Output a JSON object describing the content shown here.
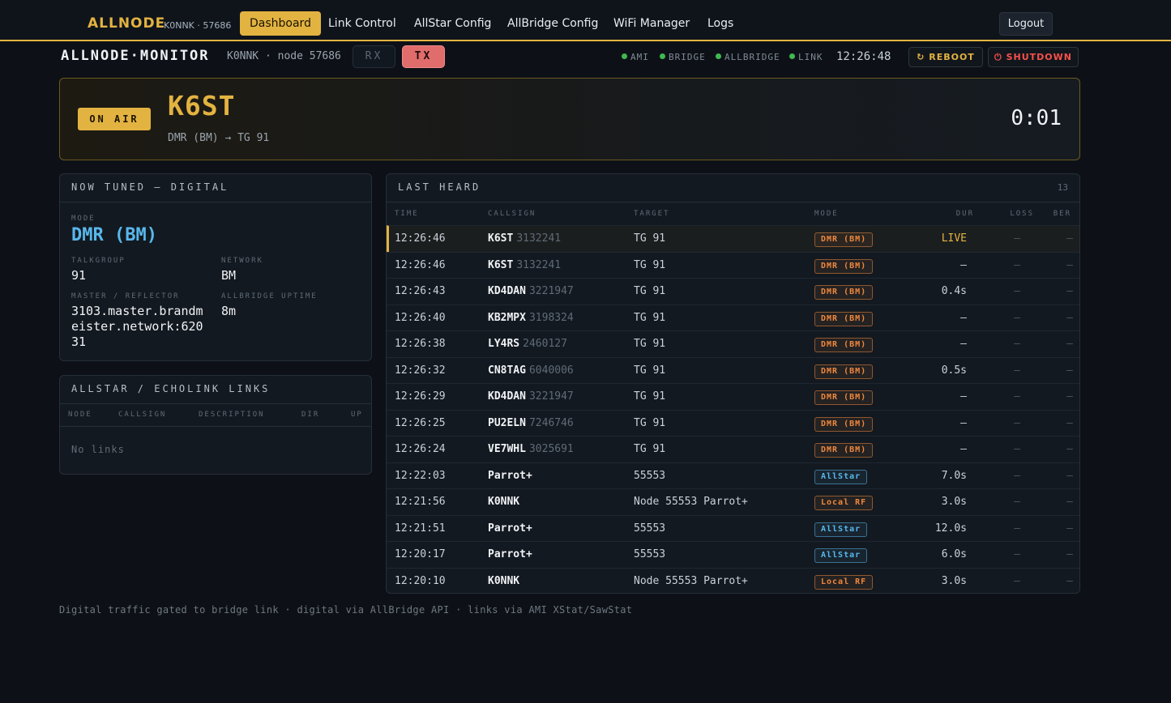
{
  "nav": {
    "brand": "ALLNODE",
    "brand_sub": "K0NNK · 57686",
    "links": [
      "Dashboard",
      "Link Control",
      "AllStar Config",
      "AllBridge Config",
      "WiFi Manager",
      "Logs"
    ],
    "active": "Dashboard",
    "logout": "Logout"
  },
  "monitor": {
    "title": "ALLNODE·MONITOR",
    "subtitle": "K0NNK · node 57686",
    "rx_label": "RX",
    "tx_label": "TX",
    "status": [
      "AMI",
      "BRIDGE",
      "ALLBRIDGE",
      "LINK"
    ],
    "status_color": "#3fb950",
    "clock": "12:26:48",
    "reboot_label": "REBOOT",
    "reboot_icon": "↻",
    "shutdown_label": "SHUTDOWN",
    "shutdown_icon": "⏻"
  },
  "onair": {
    "badge": "ON AIR",
    "callsign": "K6ST",
    "mode_line": "DMR (BM) → TG 91",
    "timer": "0:01"
  },
  "tuned": {
    "title": "NOW TUNED — DIGITAL",
    "mode_label": "MODE",
    "mode": "DMR (BM)",
    "talkgroup_label": "TALKGROUP",
    "talkgroup": "91",
    "network_label": "NETWORK",
    "network": "BM",
    "master_label": "MASTER / REFLECTOR",
    "master": "3103.master.brandmeister.network:62031",
    "uptime_label": "ALLBRIDGE UPTIME",
    "uptime": "8m"
  },
  "links_panel": {
    "title": "ALLSTAR / ECHOLINK LINKS",
    "headers": [
      "NODE",
      "CALLSIGN",
      "DESCRIPTION",
      "DIR",
      "UP"
    ],
    "empty": "No links"
  },
  "last_heard": {
    "title": "LAST HEARD",
    "count": "13",
    "headers": [
      "TIME",
      "CALLSIGN",
      "TARGET",
      "MODE",
      "DUR",
      "LOSS",
      "BER"
    ],
    "rows": [
      {
        "time": "12:26:46",
        "call": "K6ST",
        "id": "3132241",
        "target": "TG 91",
        "mode": "DMR (BM)",
        "dur": "LIVE",
        "loss": "—",
        "ber": "—"
      },
      {
        "time": "12:26:46",
        "call": "K6ST",
        "id": "3132241",
        "target": "TG 91",
        "mode": "DMR (BM)",
        "dur": "—",
        "loss": "—",
        "ber": "—"
      },
      {
        "time": "12:26:43",
        "call": "KD4DAN",
        "id": "3221947",
        "target": "TG 91",
        "mode": "DMR (BM)",
        "dur": "0.4s",
        "loss": "—",
        "ber": "—"
      },
      {
        "time": "12:26:40",
        "call": "KB2MPX",
        "id": "3198324",
        "target": "TG 91",
        "mode": "DMR (BM)",
        "dur": "—",
        "loss": "—",
        "ber": "—"
      },
      {
        "time": "12:26:38",
        "call": "LY4RS",
        "id": "2460127",
        "target": "TG 91",
        "mode": "DMR (BM)",
        "dur": "—",
        "loss": "—",
        "ber": "—"
      },
      {
        "time": "12:26:32",
        "call": "CN8TAG",
        "id": "6040006",
        "target": "TG 91",
        "mode": "DMR (BM)",
        "dur": "0.5s",
        "loss": "—",
        "ber": "—"
      },
      {
        "time": "12:26:29",
        "call": "KD4DAN",
        "id": "3221947",
        "target": "TG 91",
        "mode": "DMR (BM)",
        "dur": "—",
        "loss": "—",
        "ber": "—"
      },
      {
        "time": "12:26:25",
        "call": "PU2ELN",
        "id": "7246746",
        "target": "TG 91",
        "mode": "DMR (BM)",
        "dur": "—",
        "loss": "—",
        "ber": "—"
      },
      {
        "time": "12:26:24",
        "call": "VE7WHL",
        "id": "3025691",
        "target": "TG 91",
        "mode": "DMR (BM)",
        "dur": "—",
        "loss": "—",
        "ber": "—"
      },
      {
        "time": "12:22:03",
        "call": "Parrot+",
        "id": "",
        "target": "55553",
        "mode": "AllStar",
        "dur": "7.0s",
        "loss": "—",
        "ber": "—"
      },
      {
        "time": "12:21:56",
        "call": "K0NNK",
        "id": "",
        "target": "Node 55553 Parrot+",
        "mode": "Local RF",
        "dur": "3.0s",
        "loss": "—",
        "ber": "—"
      },
      {
        "time": "12:21:51",
        "call": "Parrot+",
        "id": "",
        "target": "55553",
        "mode": "AllStar",
        "dur": "12.0s",
        "loss": "—",
        "ber": "—"
      },
      {
        "time": "12:20:17",
        "call": "Parrot+",
        "id": "",
        "target": "55553",
        "mode": "AllStar",
        "dur": "6.0s",
        "loss": "—",
        "ber": "—"
      },
      {
        "time": "12:20:10",
        "call": "K0NNK",
        "id": "",
        "target": "Node 55553 Parrot+",
        "mode": "Local RF",
        "dur": "3.0s",
        "loss": "—",
        "ber": "—"
      }
    ],
    "mode_colors": {
      "DMR (BM)": "#f0883e",
      "AllStar": "#58b7ec",
      "Local RF": "#f0883e"
    }
  },
  "footer": "Digital traffic gated to bridge link · digital via AllBridge API · links via AMI XStat/SawStat"
}
